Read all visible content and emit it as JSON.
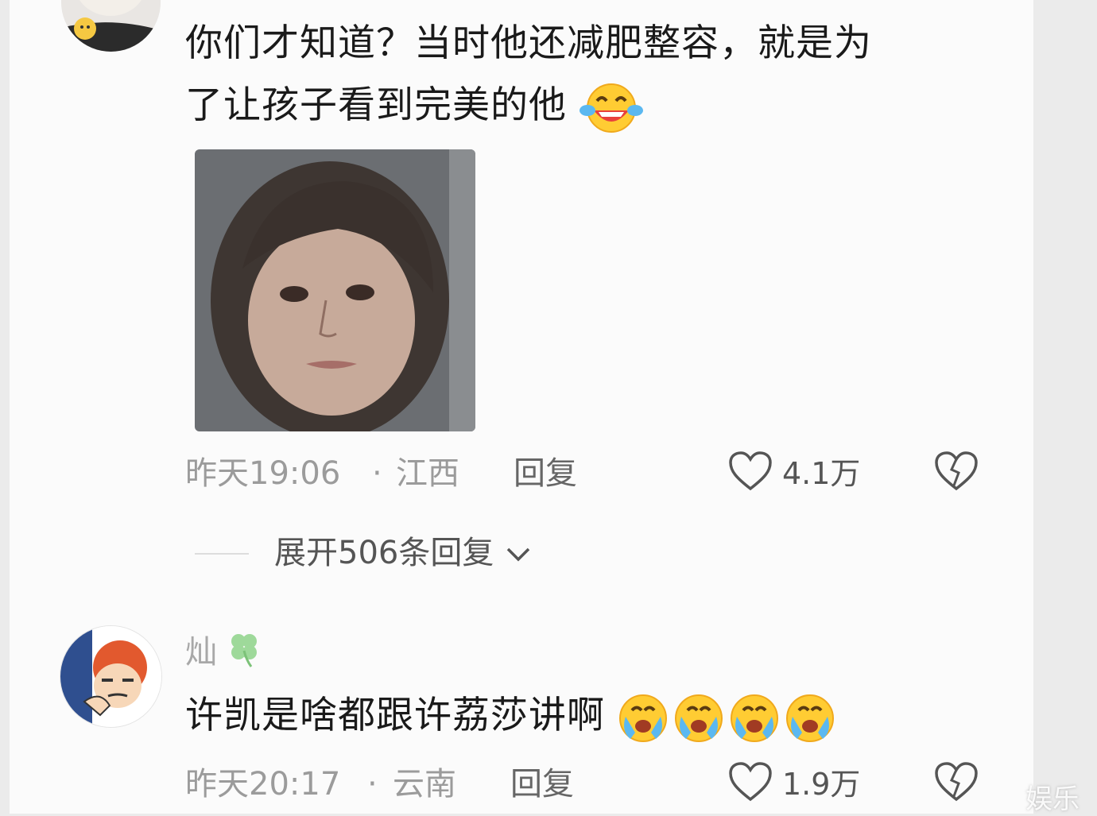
{
  "comment1": {
    "text_line1": "你们才知道？当时他还减肥整容，就是为",
    "text_line2": "了让孩子看到完美的他",
    "emoji": "laughing-tears-emoji",
    "time": "昨天19:06",
    "location": "江西",
    "reply_label": "回复",
    "likes": "4.1万",
    "expand_label": "展开506条回复"
  },
  "comment2": {
    "username": "灿",
    "username_badge": "clover-icon",
    "text": "许凯是啥都跟许荔莎讲啊",
    "emoji": "crying-emoji",
    "time": "昨天20:17",
    "location": "云南",
    "reply_label": "回复",
    "likes": "1.9万"
  },
  "watermark": "娱乐",
  "colors": {
    "card_bg": "#fbfbfb",
    "page_bg": "#ebebeb",
    "meta": "#9b9b9b"
  }
}
